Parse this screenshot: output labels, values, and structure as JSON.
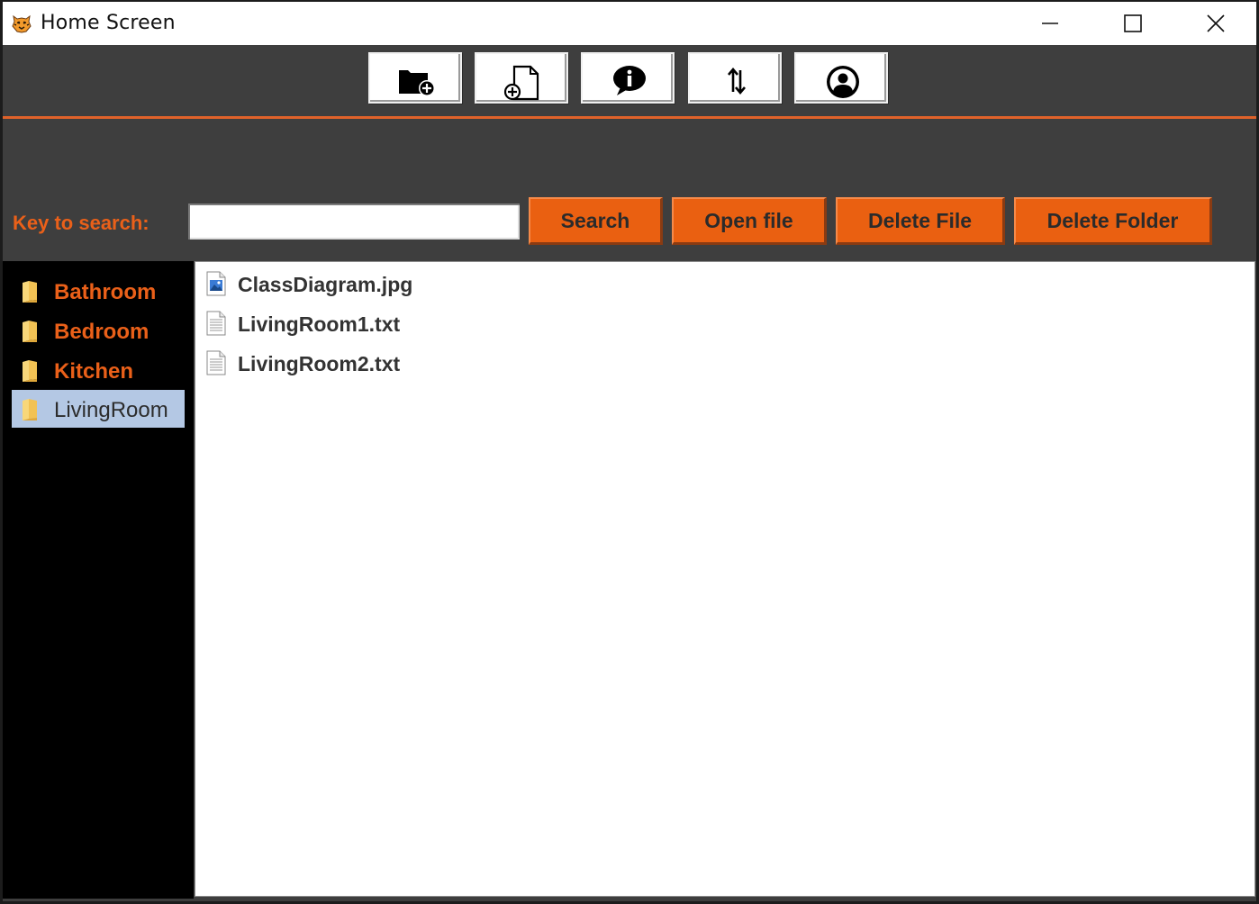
{
  "window": {
    "title": "Home Screen",
    "app_icon": "tiger-icon"
  },
  "toolbar": {
    "buttons": [
      {
        "name": "new-folder-button",
        "icon": "new-folder-icon"
      },
      {
        "name": "new-file-button",
        "icon": "new-file-icon"
      },
      {
        "name": "info-button",
        "icon": "info-icon"
      },
      {
        "name": "sort-button",
        "icon": "sort-arrows-icon"
      },
      {
        "name": "profile-button",
        "icon": "user-icon"
      }
    ]
  },
  "search": {
    "label": "Key to search:",
    "value": "",
    "buttons": {
      "search": "Search",
      "open_file": "Open file",
      "delete_file": "Delete File",
      "delete_folder": "Delete Folder"
    }
  },
  "sidebar": {
    "folders": [
      {
        "label": "Bathroom",
        "selected": false
      },
      {
        "label": "Bedroom",
        "selected": false
      },
      {
        "label": "Kitchen",
        "selected": false
      },
      {
        "label": "LivingRoom",
        "selected": true
      }
    ]
  },
  "files": [
    {
      "label": "ClassDiagram.jpg",
      "icon": "image-file-icon"
    },
    {
      "label": "LivingRoom1.txt",
      "icon": "text-file-icon"
    },
    {
      "label": "LivingRoom2.txt",
      "icon": "text-file-icon"
    }
  ],
  "colors": {
    "accent": "#ea6011",
    "background": "#3e3e3e",
    "sidebar": "#000000",
    "selection": "#b4c8e4"
  }
}
